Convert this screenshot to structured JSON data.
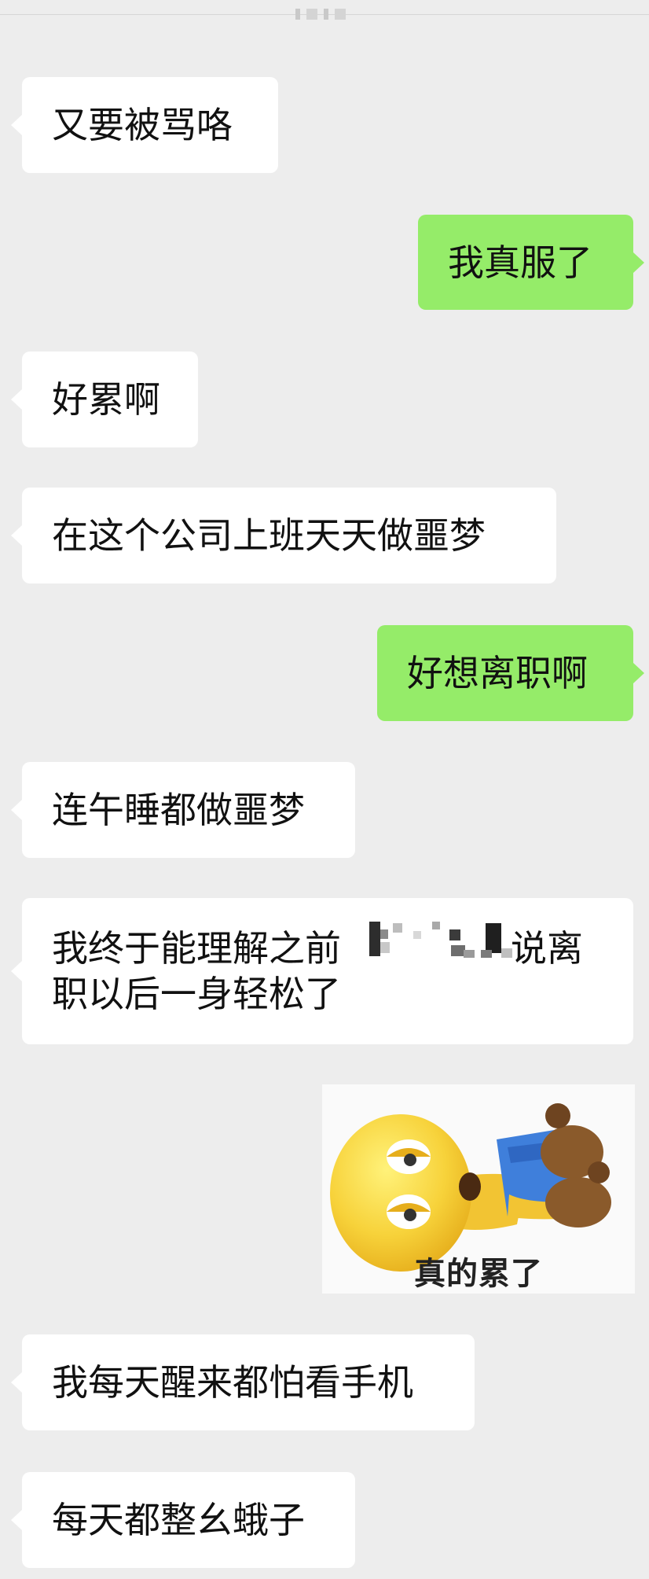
{
  "conversation": {
    "messages": [
      {
        "side": "in",
        "text": "又要被骂咯"
      },
      {
        "side": "out",
        "text": "我真服了"
      },
      {
        "side": "in",
        "text": "好累啊"
      },
      {
        "side": "in",
        "text": "在这个公司上班天天做噩梦"
      },
      {
        "side": "out",
        "text": "好想离职啊"
      },
      {
        "side": "in",
        "text": "连午睡都做噩梦"
      },
      {
        "side": "in",
        "text_line1_prefix": "我终于能理解之前",
        "text_line1_suffix": "说离",
        "text_line2": "职以后一身轻松了"
      },
      {
        "side": "out",
        "type": "sticker",
        "sticker_icon": "tired-emoji-kneeling",
        "sticker_caption": "真的累了"
      },
      {
        "side": "in",
        "text": "我每天醒来都怕看手机"
      },
      {
        "side": "in",
        "text": "每天都整幺蛾子"
      }
    ]
  },
  "colors": {
    "background": "#ededed",
    "incoming_bubble": "#ffffff",
    "outgoing_bubble": "#95ec69"
  }
}
